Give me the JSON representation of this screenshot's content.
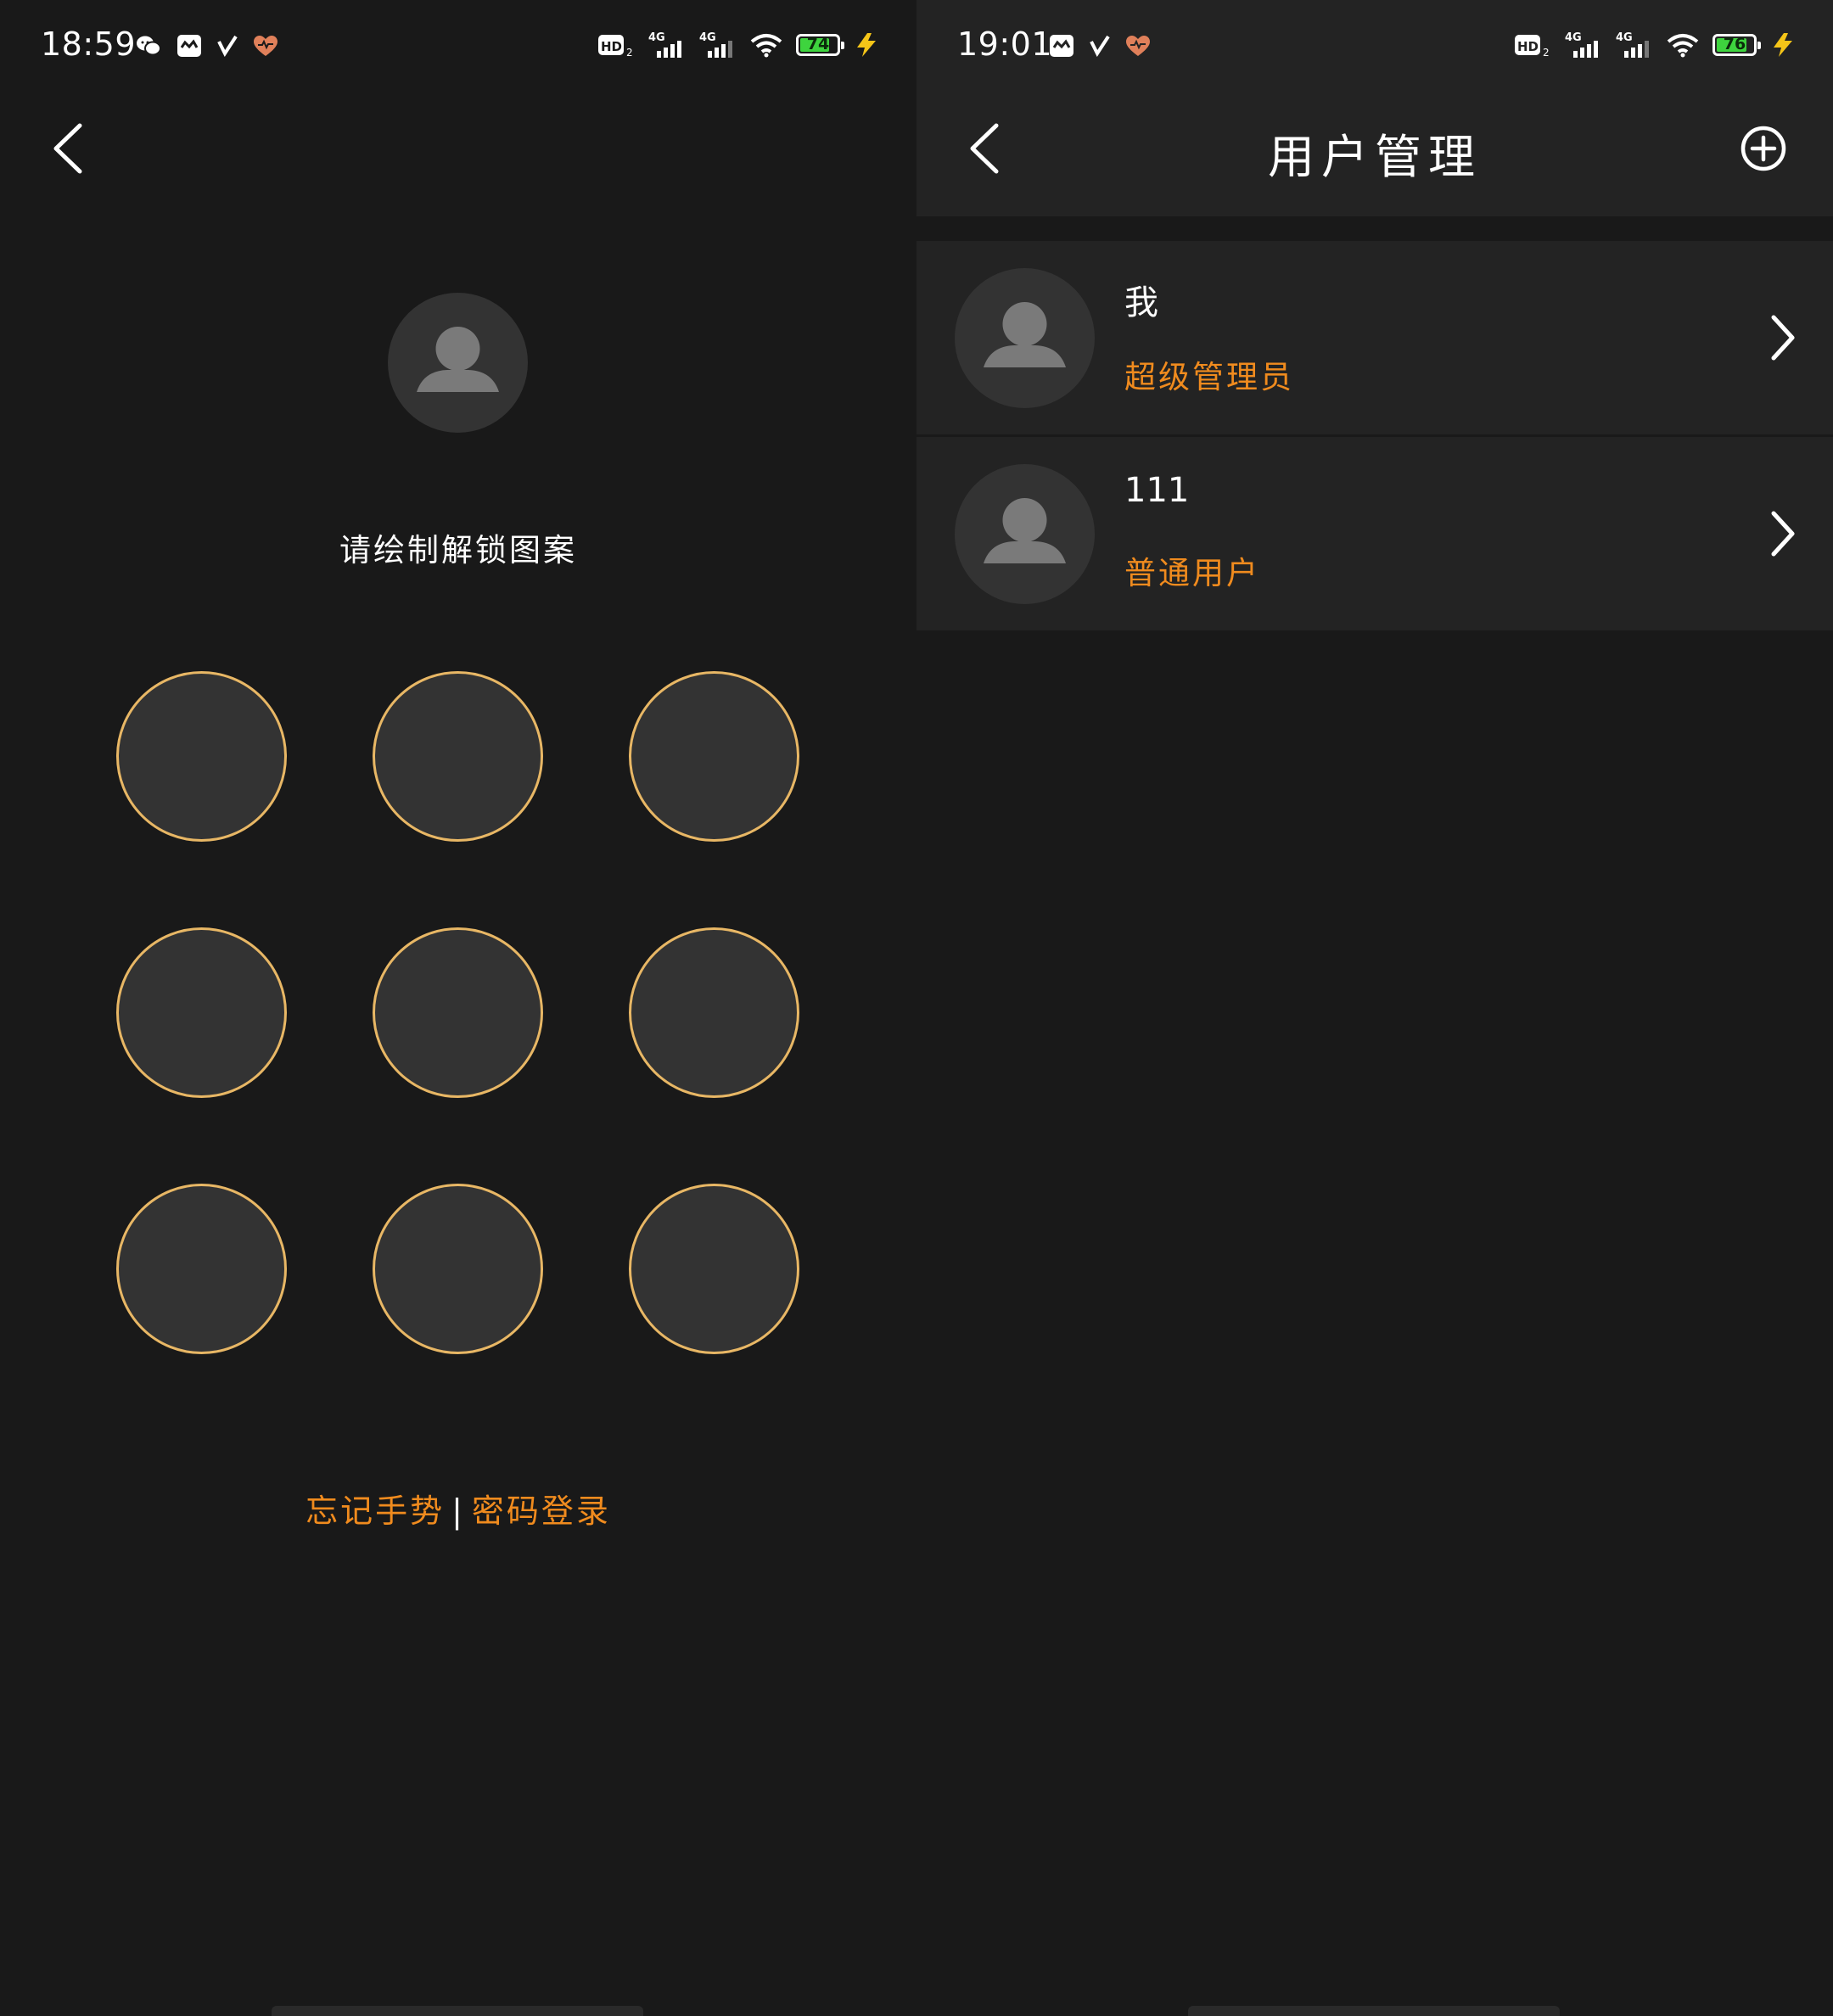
{
  "left_screen": {
    "status_bar": {
      "time": "18:59",
      "battery": "74"
    },
    "prompt": "请绘制解锁图案",
    "pattern_nodes": 9,
    "links": {
      "forgot_gesture": "忘记手势",
      "separator": "|",
      "password_login": "密码登录"
    }
  },
  "right_screen": {
    "status_bar": {
      "time": "19:01",
      "battery": "76"
    },
    "title": "用户管理",
    "users": [
      {
        "name": "我",
        "role": "超级管理员"
      },
      {
        "name": "111",
        "role": "普通用户"
      }
    ]
  },
  "colors": {
    "background": "#191919",
    "header": "#232323",
    "accent_orange": "#f08b1e",
    "node_border": "#e8b765",
    "node_fill": "#333333",
    "battery_green": "#3ed43e"
  }
}
